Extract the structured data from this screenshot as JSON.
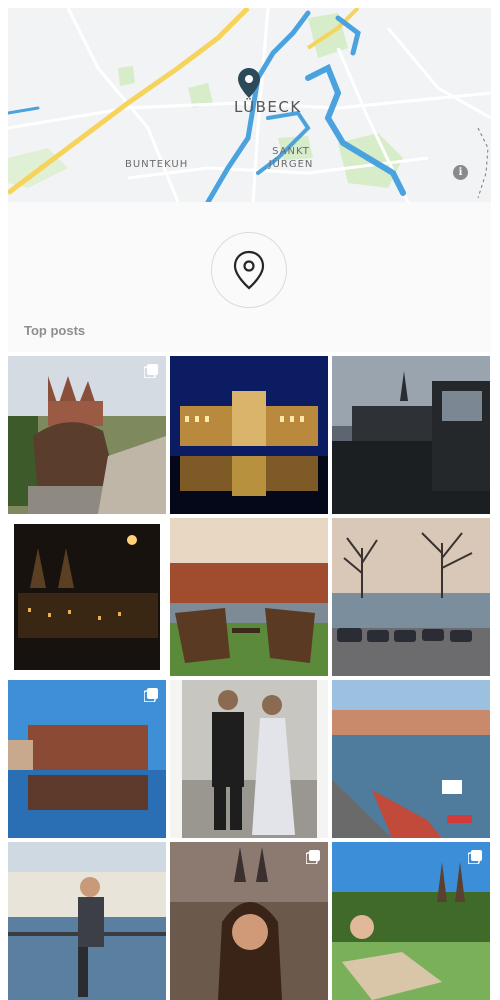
{
  "map": {
    "city_label": "LÜBECK",
    "district_1": "BUNTEKUH",
    "district_2_line1": "SANKT",
    "district_2_line2": "JÜRGEN",
    "info_glyph": "i"
  },
  "header": {
    "location_icon": "location-pin-icon"
  },
  "section": {
    "title": "Top posts"
  },
  "posts": [
    {
      "name": "lion-statue-holstentor",
      "multiple": true
    },
    {
      "name": "night-reflection-building",
      "multiple": false
    },
    {
      "name": "church-spire-dusk",
      "multiple": false
    },
    {
      "name": "cathedral-night-vignette",
      "multiple": false
    },
    {
      "name": "deckchairs-riverside",
      "multiple": false
    },
    {
      "name": "bare-trees-parking",
      "multiple": false
    },
    {
      "name": "waterfront-reflection",
      "multiple": true
    },
    {
      "name": "couple-formal",
      "multiple": false
    },
    {
      "name": "river-boat-flags",
      "multiple": false
    },
    {
      "name": "man-harbor-railing",
      "multiple": false
    },
    {
      "name": "woman-smiling-evening",
      "multiple": true
    },
    {
      "name": "woman-sunbathing-chair",
      "multiple": true
    }
  ],
  "colors": {
    "accent_pin": "#2c4a5a",
    "water": "#4aa3df",
    "park": "#d7ecc9",
    "road": "#f6d35b"
  }
}
